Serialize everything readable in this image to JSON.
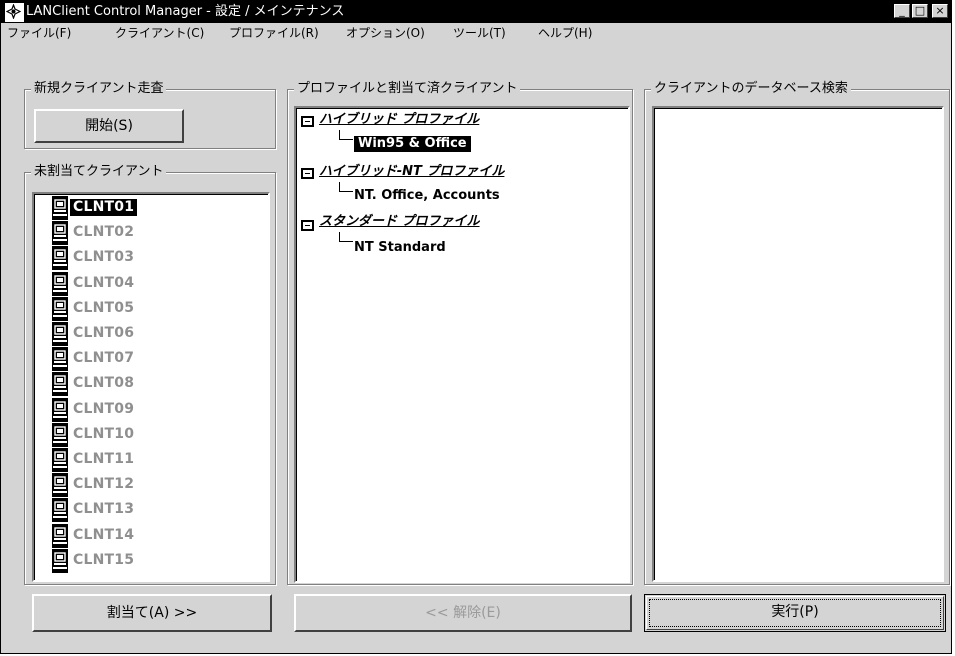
{
  "window": {
    "title": "LANClient Control Manager - 設定 / メインテナンス",
    "controls": {
      "minimize": "_",
      "maximize": "□",
      "close": "×"
    }
  },
  "menu": [
    "ファイル(F)",
    "クライアント(C)",
    "プロファイル(R)",
    "オプション(O)",
    "ツール(T)",
    "ヘルプ(H)"
  ],
  "scan_group": {
    "label": "新規クライアント走査",
    "start_button": "開始(S)"
  },
  "unassigned_group": {
    "label": "未割当てクライアント",
    "clients": [
      "CLNT01",
      "CLNT02",
      "CLNT03",
      "CLNT04",
      "CLNT05",
      "CLNT06",
      "CLNT07",
      "CLNT08",
      "CLNT09",
      "CLNT10",
      "CLNT11",
      "CLNT12",
      "CLNT13",
      "CLNT14",
      "CLNT15"
    ],
    "selected": "CLNT01",
    "assign_button": "割当て(A) >>"
  },
  "profiles_group": {
    "label": "プロファイルと割当て済クライアント",
    "profiles": [
      {
        "name": "ハイブリッド プロファイル",
        "children": [
          "Win95 & Office"
        ]
      },
      {
        "name": "ハイブリッド-NT プロファイル",
        "children": [
          "NT. Office, Accounts"
        ]
      },
      {
        "name": "スタンダード プロファイル",
        "children": [
          "NT Standard"
        ]
      }
    ],
    "selected_child": "Win95 & Office",
    "release_button": "<< 解除(E)"
  },
  "db_group": {
    "label": "クライアントのデータベース検索",
    "execute_button": "実行(P)"
  },
  "icons": {
    "app": "lan-app-icon",
    "client": "computer-icon",
    "tree_node": "collapse-minus-icon"
  },
  "colors": {
    "face": "#d4d4d4",
    "titlebar": "#000000",
    "selection": "#000000",
    "disabled_text": "#8f8f8f"
  }
}
